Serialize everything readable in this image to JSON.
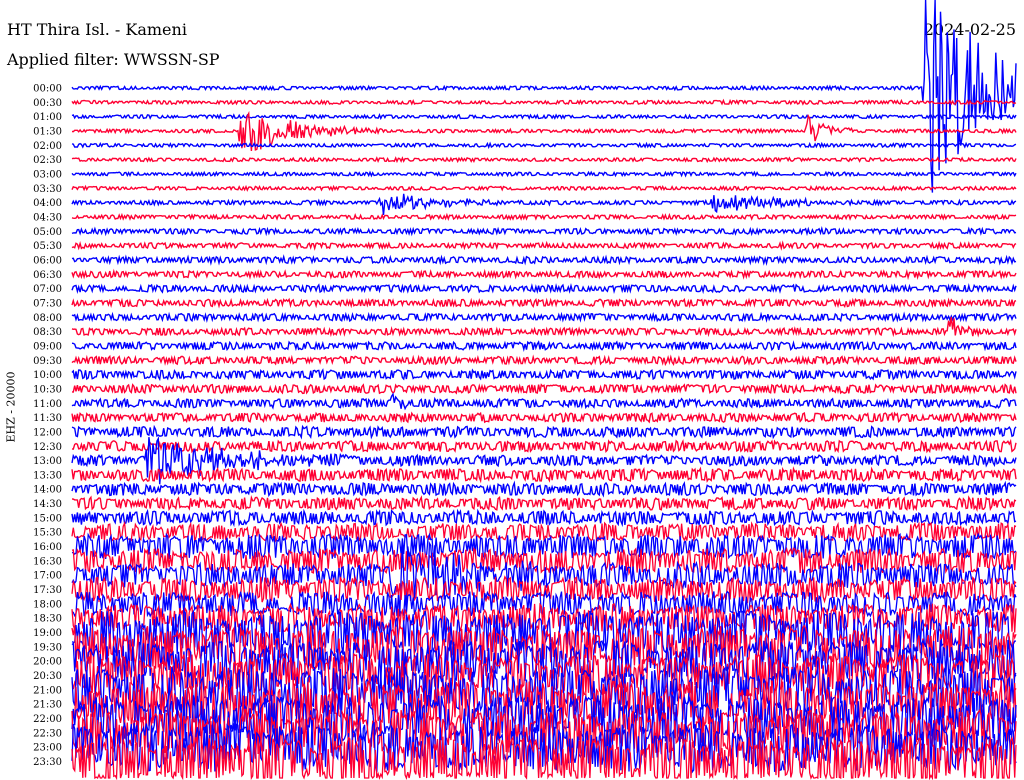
{
  "header": {
    "title": "HT Thira Isl. - Kameni",
    "filter": "Applied filter: WWSSN-SP",
    "date": "2024-02-25"
  },
  "chart_data": {
    "type": "line",
    "title": "HT Thira Isl. - Kameni",
    "subtitle": "Applied filter: WWSSN-SP",
    "ylabel": "EHZ - 20000",
    "xlabel": "",
    "row_labels": [
      "00:00",
      "00:30",
      "01:00",
      "01:30",
      "02:00",
      "02:30",
      "03:00",
      "03:30",
      "04:00",
      "04:30",
      "05:00",
      "05:30",
      "06:00",
      "06:30",
      "07:00",
      "07:30",
      "08:00",
      "08:30",
      "09:00",
      "09:30",
      "10:00",
      "10:30",
      "11:00",
      "11:30",
      "12:00",
      "12:30",
      "13:00",
      "13:30",
      "14:00",
      "14:30",
      "15:00",
      "15:30",
      "16:00",
      "16:30",
      "17:00",
      "17:30",
      "18:00",
      "18:30",
      "19:00",
      "19:30",
      "20:00",
      "20:30",
      "21:00",
      "21:30",
      "22:00",
      "22:30",
      "23:00",
      "23:30"
    ],
    "trace_colors": [
      "#0000ff",
      "#ff0033"
    ],
    "noise_level": [
      1,
      1,
      1,
      1,
      1,
      1,
      1,
      1,
      1.2,
      1.2,
      1.5,
      1.5,
      1.8,
      1.8,
      2,
      2,
      2,
      2,
      2.2,
      2.2,
      2.5,
      2.5,
      2.5,
      2.5,
      3,
      3,
      3,
      3.5,
      3.5,
      3.5,
      4,
      5,
      7,
      7,
      7,
      7,
      7,
      8,
      12,
      12,
      12,
      12,
      13,
      13,
      13,
      13,
      14,
      14
    ],
    "events": [
      {
        "row": 0,
        "pos": 0.905,
        "amp": 120,
        "dur": 0.06
      },
      {
        "row": 3,
        "pos": 0.18,
        "amp": 26,
        "dur": 0.05
      },
      {
        "row": 3,
        "pos": 0.78,
        "amp": 14,
        "dur": 0.02
      },
      {
        "row": 8,
        "pos": 0.33,
        "amp": 12,
        "dur": 0.05
      },
      {
        "row": 8,
        "pos": 0.68,
        "amp": 12,
        "dur": 0.05
      },
      {
        "row": 17,
        "pos": 0.93,
        "amp": 16,
        "dur": 0.01
      },
      {
        "row": 22,
        "pos": 0.34,
        "amp": 12,
        "dur": 0.01
      },
      {
        "row": 26,
        "pos": 0.08,
        "amp": 30,
        "dur": 0.07
      },
      {
        "row": 34,
        "pos": 0.34,
        "amp": 45,
        "dur": 0.06
      }
    ]
  }
}
